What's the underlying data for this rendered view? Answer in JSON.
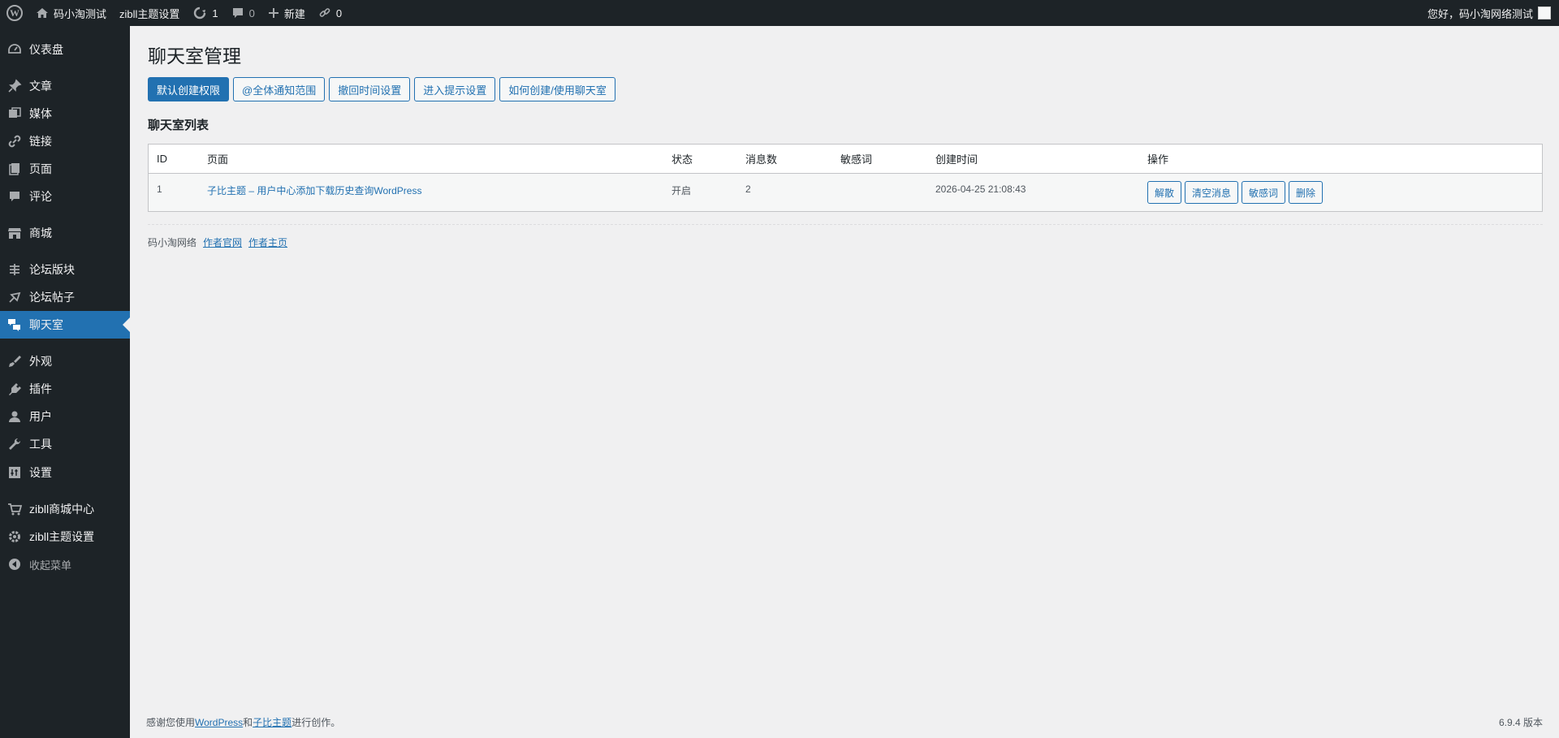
{
  "adminbar": {
    "site_name": "码小淘测试",
    "theme_settings": "zibll主题设置",
    "updates_count": "1",
    "comments_count": "0",
    "new_label": "新建",
    "links_count": "0",
    "greeting": "您好，码小淘网络测试"
  },
  "sidebar": {
    "items": [
      {
        "label": "仪表盘",
        "icon": "dashboard-icon"
      },
      {
        "label": "文章",
        "icon": "pin-icon"
      },
      {
        "label": "媒体",
        "icon": "media-icon"
      },
      {
        "label": "链接",
        "icon": "link-icon"
      },
      {
        "label": "页面",
        "icon": "page-icon"
      },
      {
        "label": "评论",
        "icon": "comment-icon"
      },
      {
        "label": "商城",
        "icon": "store-icon"
      },
      {
        "label": "论坛版块",
        "icon": "forum-section-icon"
      },
      {
        "label": "论坛帖子",
        "icon": "forum-post-icon"
      },
      {
        "label": "聊天室",
        "icon": "chat-icon"
      },
      {
        "label": "外观",
        "icon": "brush-icon"
      },
      {
        "label": "插件",
        "icon": "plugin-icon"
      },
      {
        "label": "用户",
        "icon": "user-icon"
      },
      {
        "label": "工具",
        "icon": "wrench-icon"
      },
      {
        "label": "设置",
        "icon": "settings-icon"
      },
      {
        "label": "zibll商城中心",
        "icon": "cart-icon"
      },
      {
        "label": "zibll主题设置",
        "icon": "gear-icon"
      },
      {
        "label": "收起菜单",
        "icon": "collapse-icon"
      }
    ],
    "current": "聊天室"
  },
  "main": {
    "page_title": "聊天室管理",
    "tabs": [
      {
        "label": "默认创建权限",
        "active": true
      },
      {
        "label": "@全体通知范围",
        "active": false
      },
      {
        "label": "撤回时间设置",
        "active": false
      },
      {
        "label": "进入提示设置",
        "active": false
      },
      {
        "label": "如何创建/使用聊天室",
        "active": false
      }
    ],
    "section_title": "聊天室列表",
    "table": {
      "headers": {
        "id": "ID",
        "page": "页面",
        "status": "状态",
        "messages": "消息数",
        "sensitive": "敏感词",
        "created": "创建时间",
        "actions": "操作"
      },
      "rows": [
        {
          "id": "1",
          "page": "子比主题 – 用户中心添加下载历史查询WordPress",
          "status": "开启",
          "messages": "2",
          "sensitive": "",
          "created": "2026-04-25 21:08:43",
          "actions": [
            "解散",
            "清空消息",
            "敏感词",
            "删除"
          ]
        }
      ]
    },
    "credits": {
      "brand": "码小淘网络",
      "link1": "作者官网",
      "link2": "作者主页"
    }
  },
  "footer": {
    "thanks_prefix": "感谢您使用",
    "wordpress": "WordPress",
    "and": "和",
    "theme": "子比主题",
    "suffix": "进行创作。",
    "version": "6.9.4 版本"
  },
  "colors": {
    "accent": "#2271b1",
    "sidebar_bg": "#1d2327",
    "page_bg": "#f0f0f1"
  }
}
